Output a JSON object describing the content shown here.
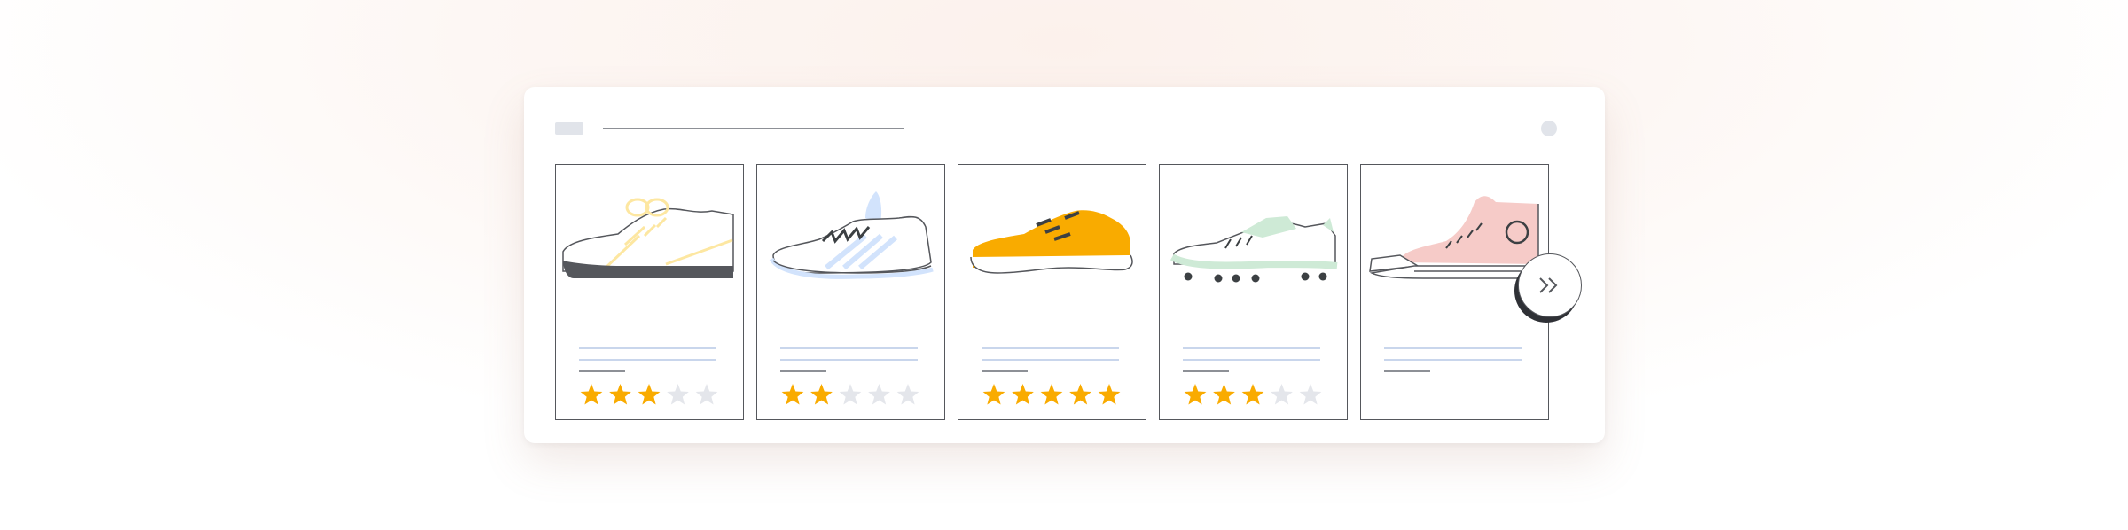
{
  "colors": {
    "star_filled": "#f9ab00",
    "star_empty": "#e4e6eb",
    "outline": "#55575c",
    "placeholder_line": "#c9d6ec"
  },
  "header": {
    "icon": "window-tab-chip",
    "close_icon": "window-dot-icon"
  },
  "products": [
    {
      "name": "",
      "shoe": "white-sneaker-icon",
      "accent": "#fde7a1",
      "rating": 3,
      "max_rating": 5
    },
    {
      "name": "",
      "shoe": "running-shoe-icon",
      "accent": "#d2e3fc",
      "rating": 2,
      "max_rating": 5
    },
    {
      "name": "",
      "shoe": "yellow-sneaker-icon",
      "accent": "#f9ab00",
      "rating": 5,
      "max_rating": 5
    },
    {
      "name": "",
      "shoe": "soccer-cleat-icon",
      "accent": "#ceead6",
      "rating": 3,
      "max_rating": 5
    },
    {
      "name": "",
      "shoe": "high-top-sneaker-icon",
      "accent": "#f6cbc8",
      "rating": null,
      "max_rating": 5
    }
  ],
  "carousel": {
    "next_icon": "double-chevron-right-icon"
  }
}
